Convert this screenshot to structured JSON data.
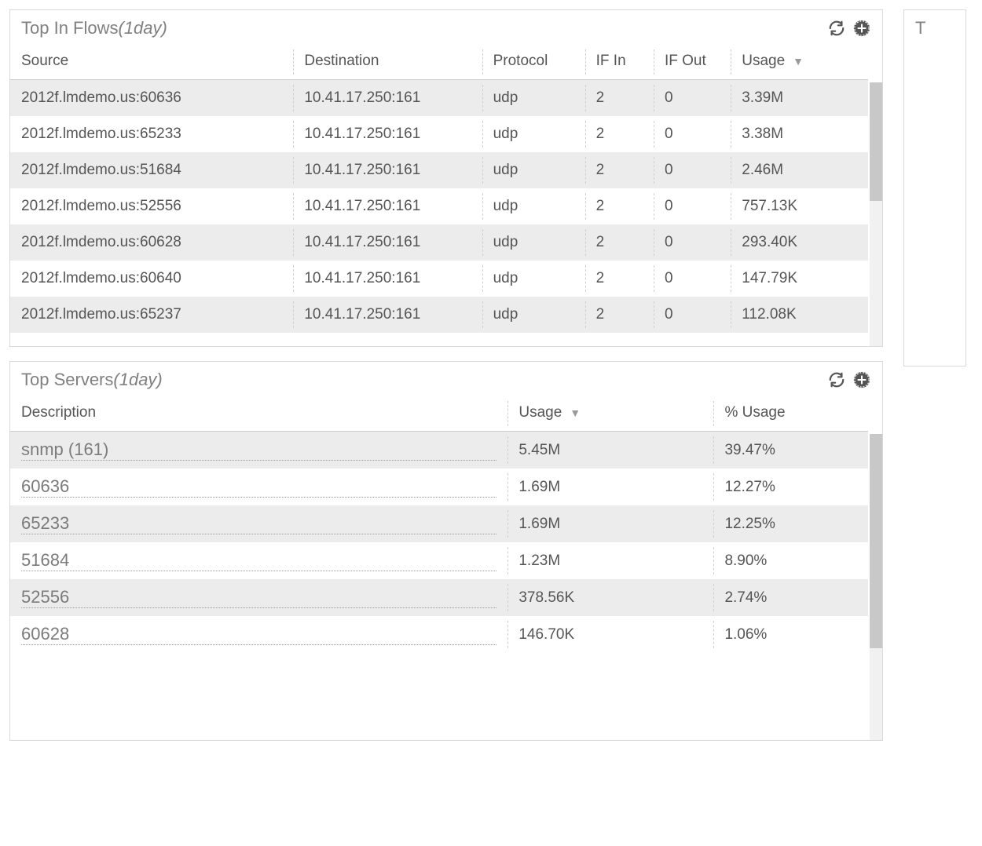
{
  "panels": {
    "flows": {
      "title_main": "Top In Flows",
      "title_period": "(1day)",
      "columns": [
        "Source",
        "Destination",
        "Protocol",
        "IF In",
        "IF Out",
        "Usage"
      ],
      "sort_column_index": 5,
      "rows": [
        {
          "source": "2012f.lmdemo.us:60636",
          "dest": "10.41.17.250:161",
          "proto": "udp",
          "ifin": "2",
          "ifout": "0",
          "usage": "3.39M"
        },
        {
          "source": "2012f.lmdemo.us:65233",
          "dest": "10.41.17.250:161",
          "proto": "udp",
          "ifin": "2",
          "ifout": "0",
          "usage": "3.38M"
        },
        {
          "source": "2012f.lmdemo.us:51684",
          "dest": "10.41.17.250:161",
          "proto": "udp",
          "ifin": "2",
          "ifout": "0",
          "usage": "2.46M"
        },
        {
          "source": "2012f.lmdemo.us:52556",
          "dest": "10.41.17.250:161",
          "proto": "udp",
          "ifin": "2",
          "ifout": "0",
          "usage": "757.13K"
        },
        {
          "source": "2012f.lmdemo.us:60628",
          "dest": "10.41.17.250:161",
          "proto": "udp",
          "ifin": "2",
          "ifout": "0",
          "usage": "293.40K"
        },
        {
          "source": "2012f.lmdemo.us:60640",
          "dest": "10.41.17.250:161",
          "proto": "udp",
          "ifin": "2",
          "ifout": "0",
          "usage": "147.79K"
        },
        {
          "source": "2012f.lmdemo.us:65237",
          "dest": "10.41.17.250:161",
          "proto": "udp",
          "ifin": "2",
          "ifout": "0",
          "usage": "112.08K"
        }
      ]
    },
    "servers": {
      "title_main": "Top Servers",
      "title_period": "(1day)",
      "columns": [
        "Description",
        "Usage",
        "% Usage"
      ],
      "sort_column_index": 1,
      "rows": [
        {
          "desc": "snmp (161)",
          "usage": "5.45M",
          "pct": "39.47%"
        },
        {
          "desc": "60636",
          "usage": "1.69M",
          "pct": "12.27%"
        },
        {
          "desc": "65233",
          "usage": "1.69M",
          "pct": "12.25%"
        },
        {
          "desc": "51684",
          "usage": "1.23M",
          "pct": "8.90%"
        },
        {
          "desc": "52556",
          "usage": "378.56K",
          "pct": "2.74%"
        },
        {
          "desc": "60628",
          "usage": "146.70K",
          "pct": "1.06%"
        }
      ]
    }
  },
  "neighbor_panel_letter": "T",
  "icons": {
    "refresh": "refresh-icon",
    "add": "add-circle-icon",
    "sort_desc": "▼"
  }
}
